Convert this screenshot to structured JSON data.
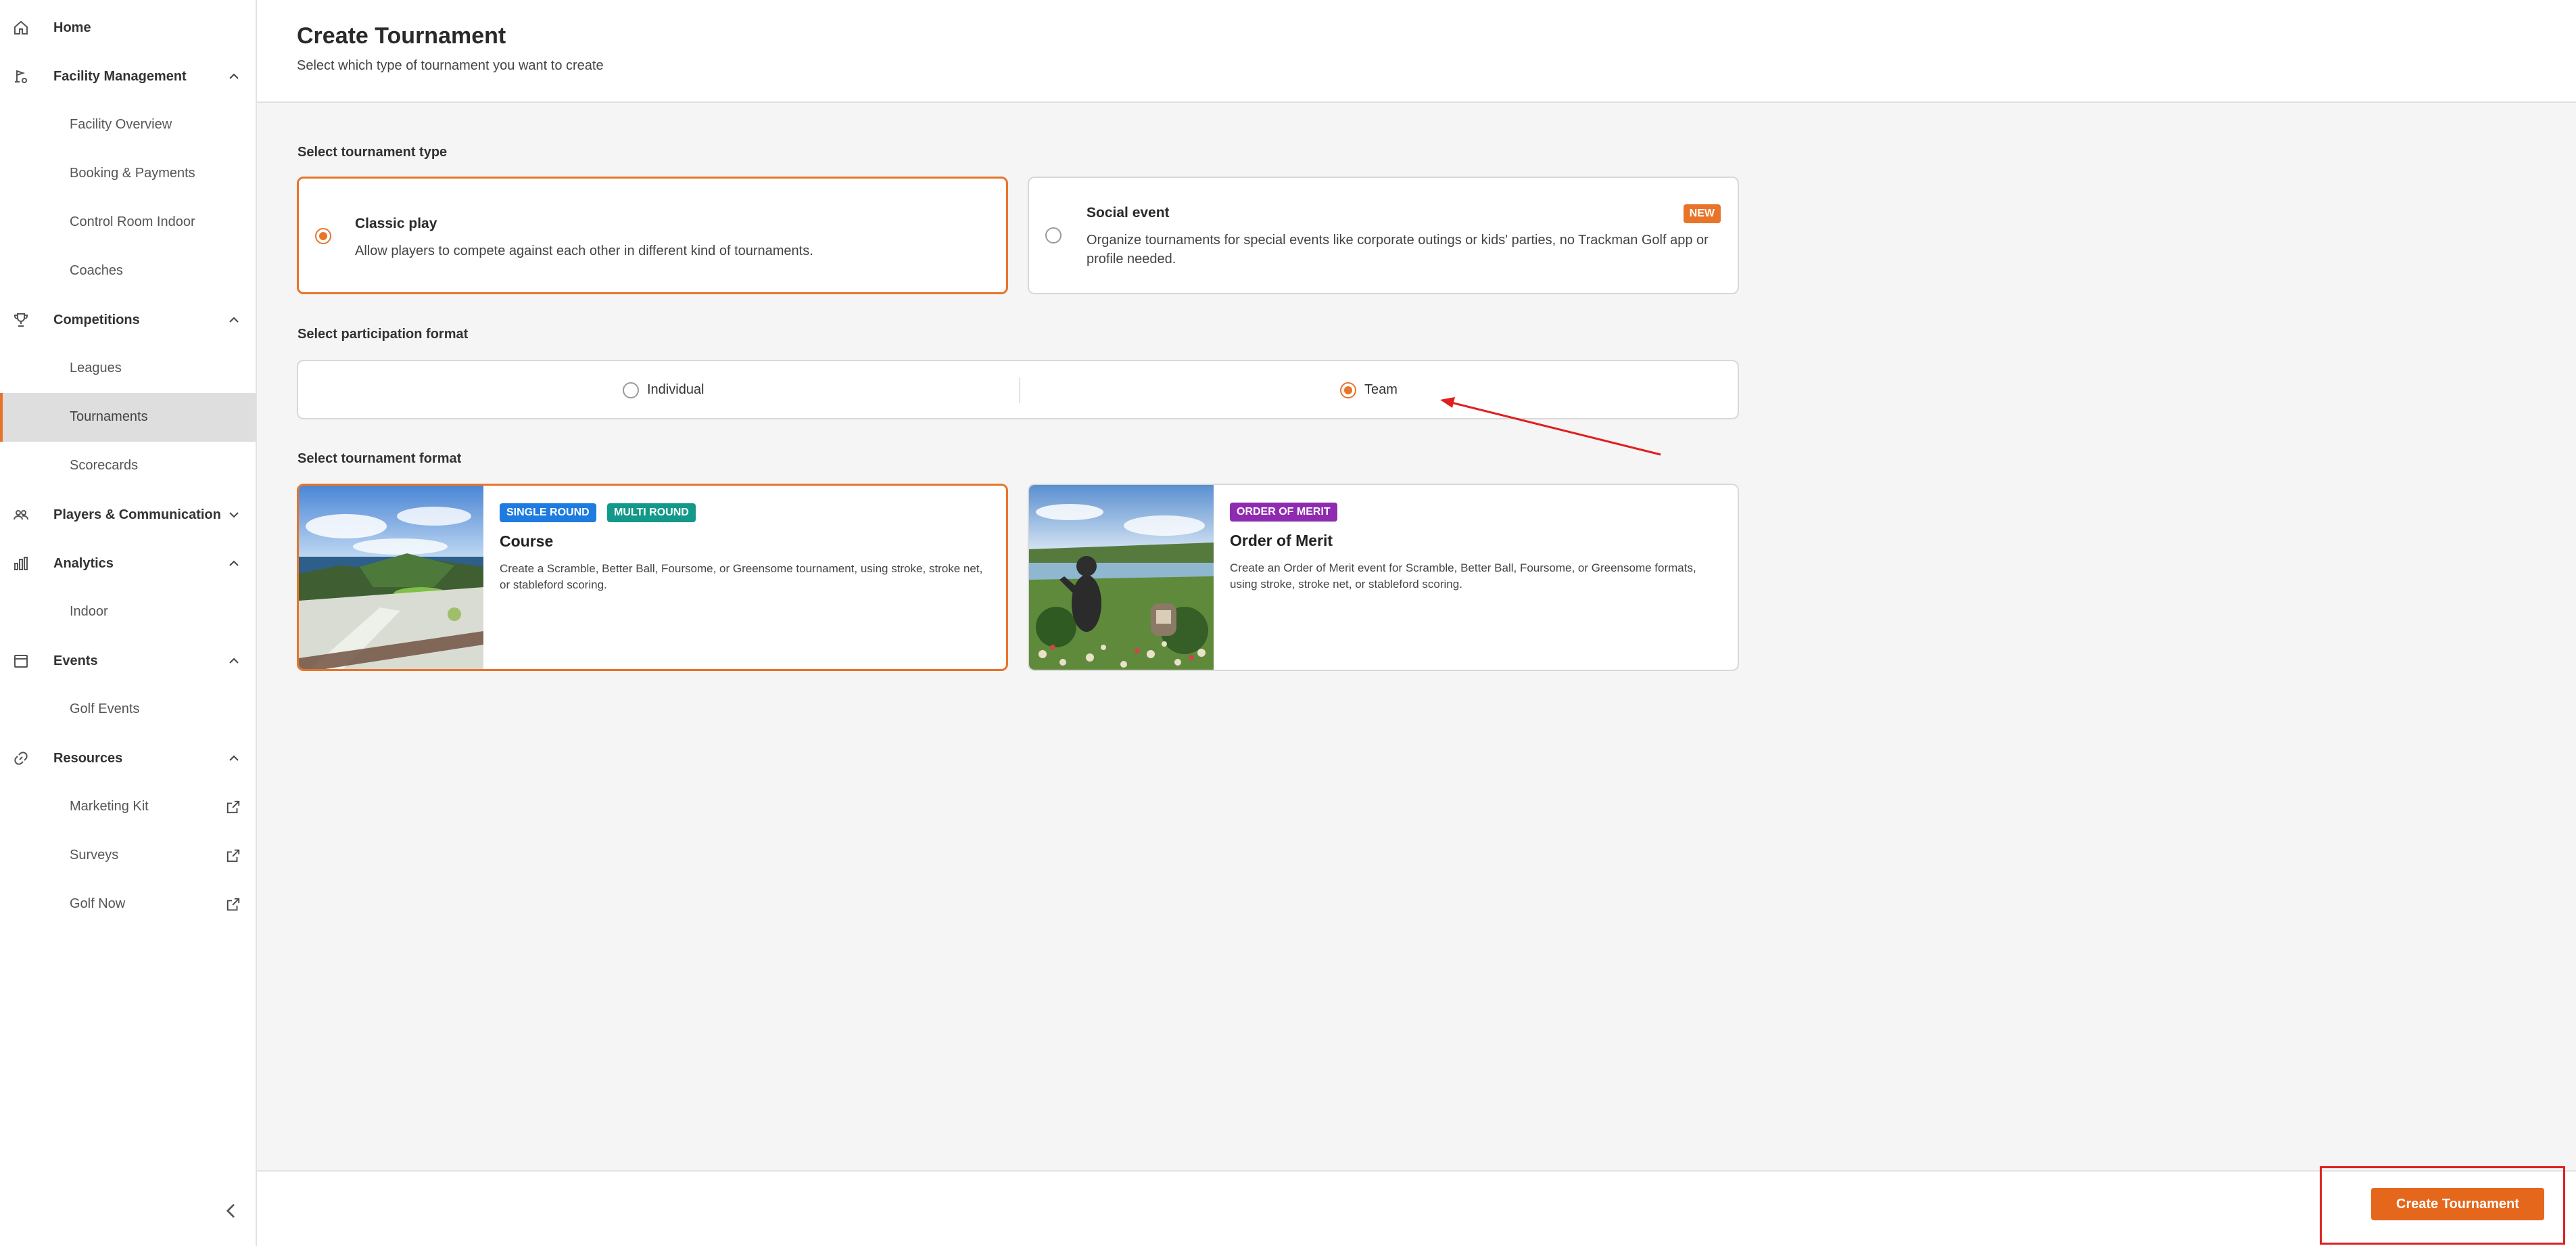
{
  "sidebar": {
    "home": {
      "label": "Home",
      "icon": "home-icon"
    },
    "facility_management": {
      "label": "Facility Management",
      "icon": "facility-icon",
      "items": [
        "Facility Overview",
        "Booking & Payments",
        "Control Room Indoor",
        "Coaches"
      ]
    },
    "competitions": {
      "label": "Competitions",
      "icon": "trophy-icon",
      "items": [
        "Leagues",
        "Tournaments",
        "Scorecards"
      ],
      "active_item": "Tournaments"
    },
    "players": {
      "label": "Players & Communication",
      "icon": "people-icon"
    },
    "analytics": {
      "label": "Analytics",
      "icon": "bar-chart-icon",
      "items": [
        "Indoor"
      ]
    },
    "events": {
      "label": "Events",
      "icon": "calendar-icon",
      "items": [
        "Golf Events"
      ]
    },
    "resources": {
      "label": "Resources",
      "icon": "link-icon",
      "items": [
        "Marketing Kit",
        "Surveys",
        "Golf Now"
      ]
    }
  },
  "header": {
    "title": "Create Tournament",
    "subtitle": "Select which type of tournament you want to create"
  },
  "tournament_type": {
    "label": "Select tournament type",
    "options": [
      {
        "title": "Classic play",
        "description": "Allow players to compete against each other in different kind of tournaments.",
        "selected": true
      },
      {
        "title": "Social event",
        "description": "Organize tournaments for special events like corporate outings or kids' parties, no Trackman Golf app or profile needed.",
        "badge": "NEW",
        "selected": false
      }
    ]
  },
  "participation_format": {
    "label": "Select participation format",
    "options": [
      {
        "label": "Individual",
        "selected": false
      },
      {
        "label": "Team",
        "selected": true
      }
    ]
  },
  "tournament_format": {
    "label": "Select tournament format",
    "options": [
      {
        "tags": [
          "SINGLE ROUND",
          "MULTI ROUND"
        ],
        "title": "Course",
        "description": "Create a Scramble, Better Ball, Foursome, or Greensome tournament, using stroke, stroke net, or stableford scoring.",
        "selected": true
      },
      {
        "tags": [
          "ORDER OF MERIT"
        ],
        "title": "Order of Merit",
        "description": "Create an Order of Merit event for Scramble, Better Ball, Foursome, or Greensome formats, using stroke, stroke net, or stableford scoring.",
        "selected": false
      }
    ]
  },
  "footer": {
    "create_button": "Create Tournament"
  },
  "colors": {
    "accent": "#e8742a",
    "button": "#e5671c",
    "tag_single_round": "#1e7be0",
    "tag_multi_round": "#13998a",
    "tag_order_of_merit": "#8e2bb0",
    "annotation": "#e02020"
  }
}
